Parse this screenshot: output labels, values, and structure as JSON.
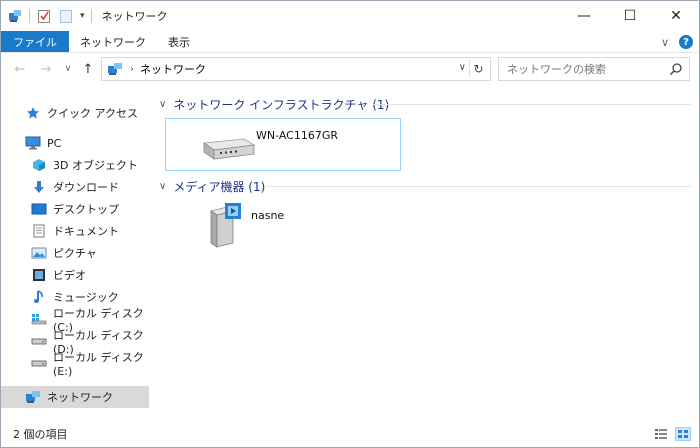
{
  "window": {
    "title": "ネットワーク"
  },
  "titlebar": {
    "minimize": "—",
    "maximize": "☐",
    "close": "✕"
  },
  "ribbon": {
    "tabs": [
      {
        "label": "ファイル"
      },
      {
        "label": "ネットワーク"
      },
      {
        "label": "表示"
      }
    ],
    "collapse_glyph": "∨",
    "help_glyph": "?"
  },
  "address": {
    "back": "←",
    "forward": "→",
    "recent": "∨",
    "up": "↑",
    "separator": "›",
    "path": "ネットワーク",
    "dropdown": "∨",
    "refresh": "↻"
  },
  "search": {
    "placeholder": "ネットワークの検索"
  },
  "navpane": {
    "items": [
      {
        "label": "クイック アクセス",
        "icon": "star-icon"
      },
      {
        "label": "PC",
        "icon": "pc-icon"
      },
      {
        "label": "3D オブジェクト",
        "icon": "3d-objects-icon"
      },
      {
        "label": "ダウンロード",
        "icon": "download-icon"
      },
      {
        "label": "デスクトップ",
        "icon": "desktop-icon"
      },
      {
        "label": "ドキュメント",
        "icon": "document-icon"
      },
      {
        "label": "ピクチャ",
        "icon": "pictures-icon"
      },
      {
        "label": "ビデオ",
        "icon": "video-icon"
      },
      {
        "label": "ミュージック",
        "icon": "music-icon"
      },
      {
        "label": "ローカル ディスク (C:)",
        "icon": "drive-c-icon"
      },
      {
        "label": "ローカル ディスク (D:)",
        "icon": "drive-icon"
      },
      {
        "label": "ローカル ディスク (E:)",
        "icon": "drive-icon"
      },
      {
        "label": "ネットワーク",
        "icon": "network-icon"
      }
    ]
  },
  "content": {
    "groups": [
      {
        "title": "ネットワーク インフラストラクチャ (1)",
        "items": [
          {
            "label": "WN-AC1167GR",
            "icon": "router-icon"
          }
        ]
      },
      {
        "title": "メディア機器 (1)",
        "items": [
          {
            "label": "nasne",
            "icon": "media-server-icon"
          }
        ]
      }
    ]
  },
  "status": {
    "text": "2 個の項目"
  },
  "colors": {
    "accent": "#1979ca",
    "selection": "#cce8ff",
    "group_title": "#1e3287"
  }
}
